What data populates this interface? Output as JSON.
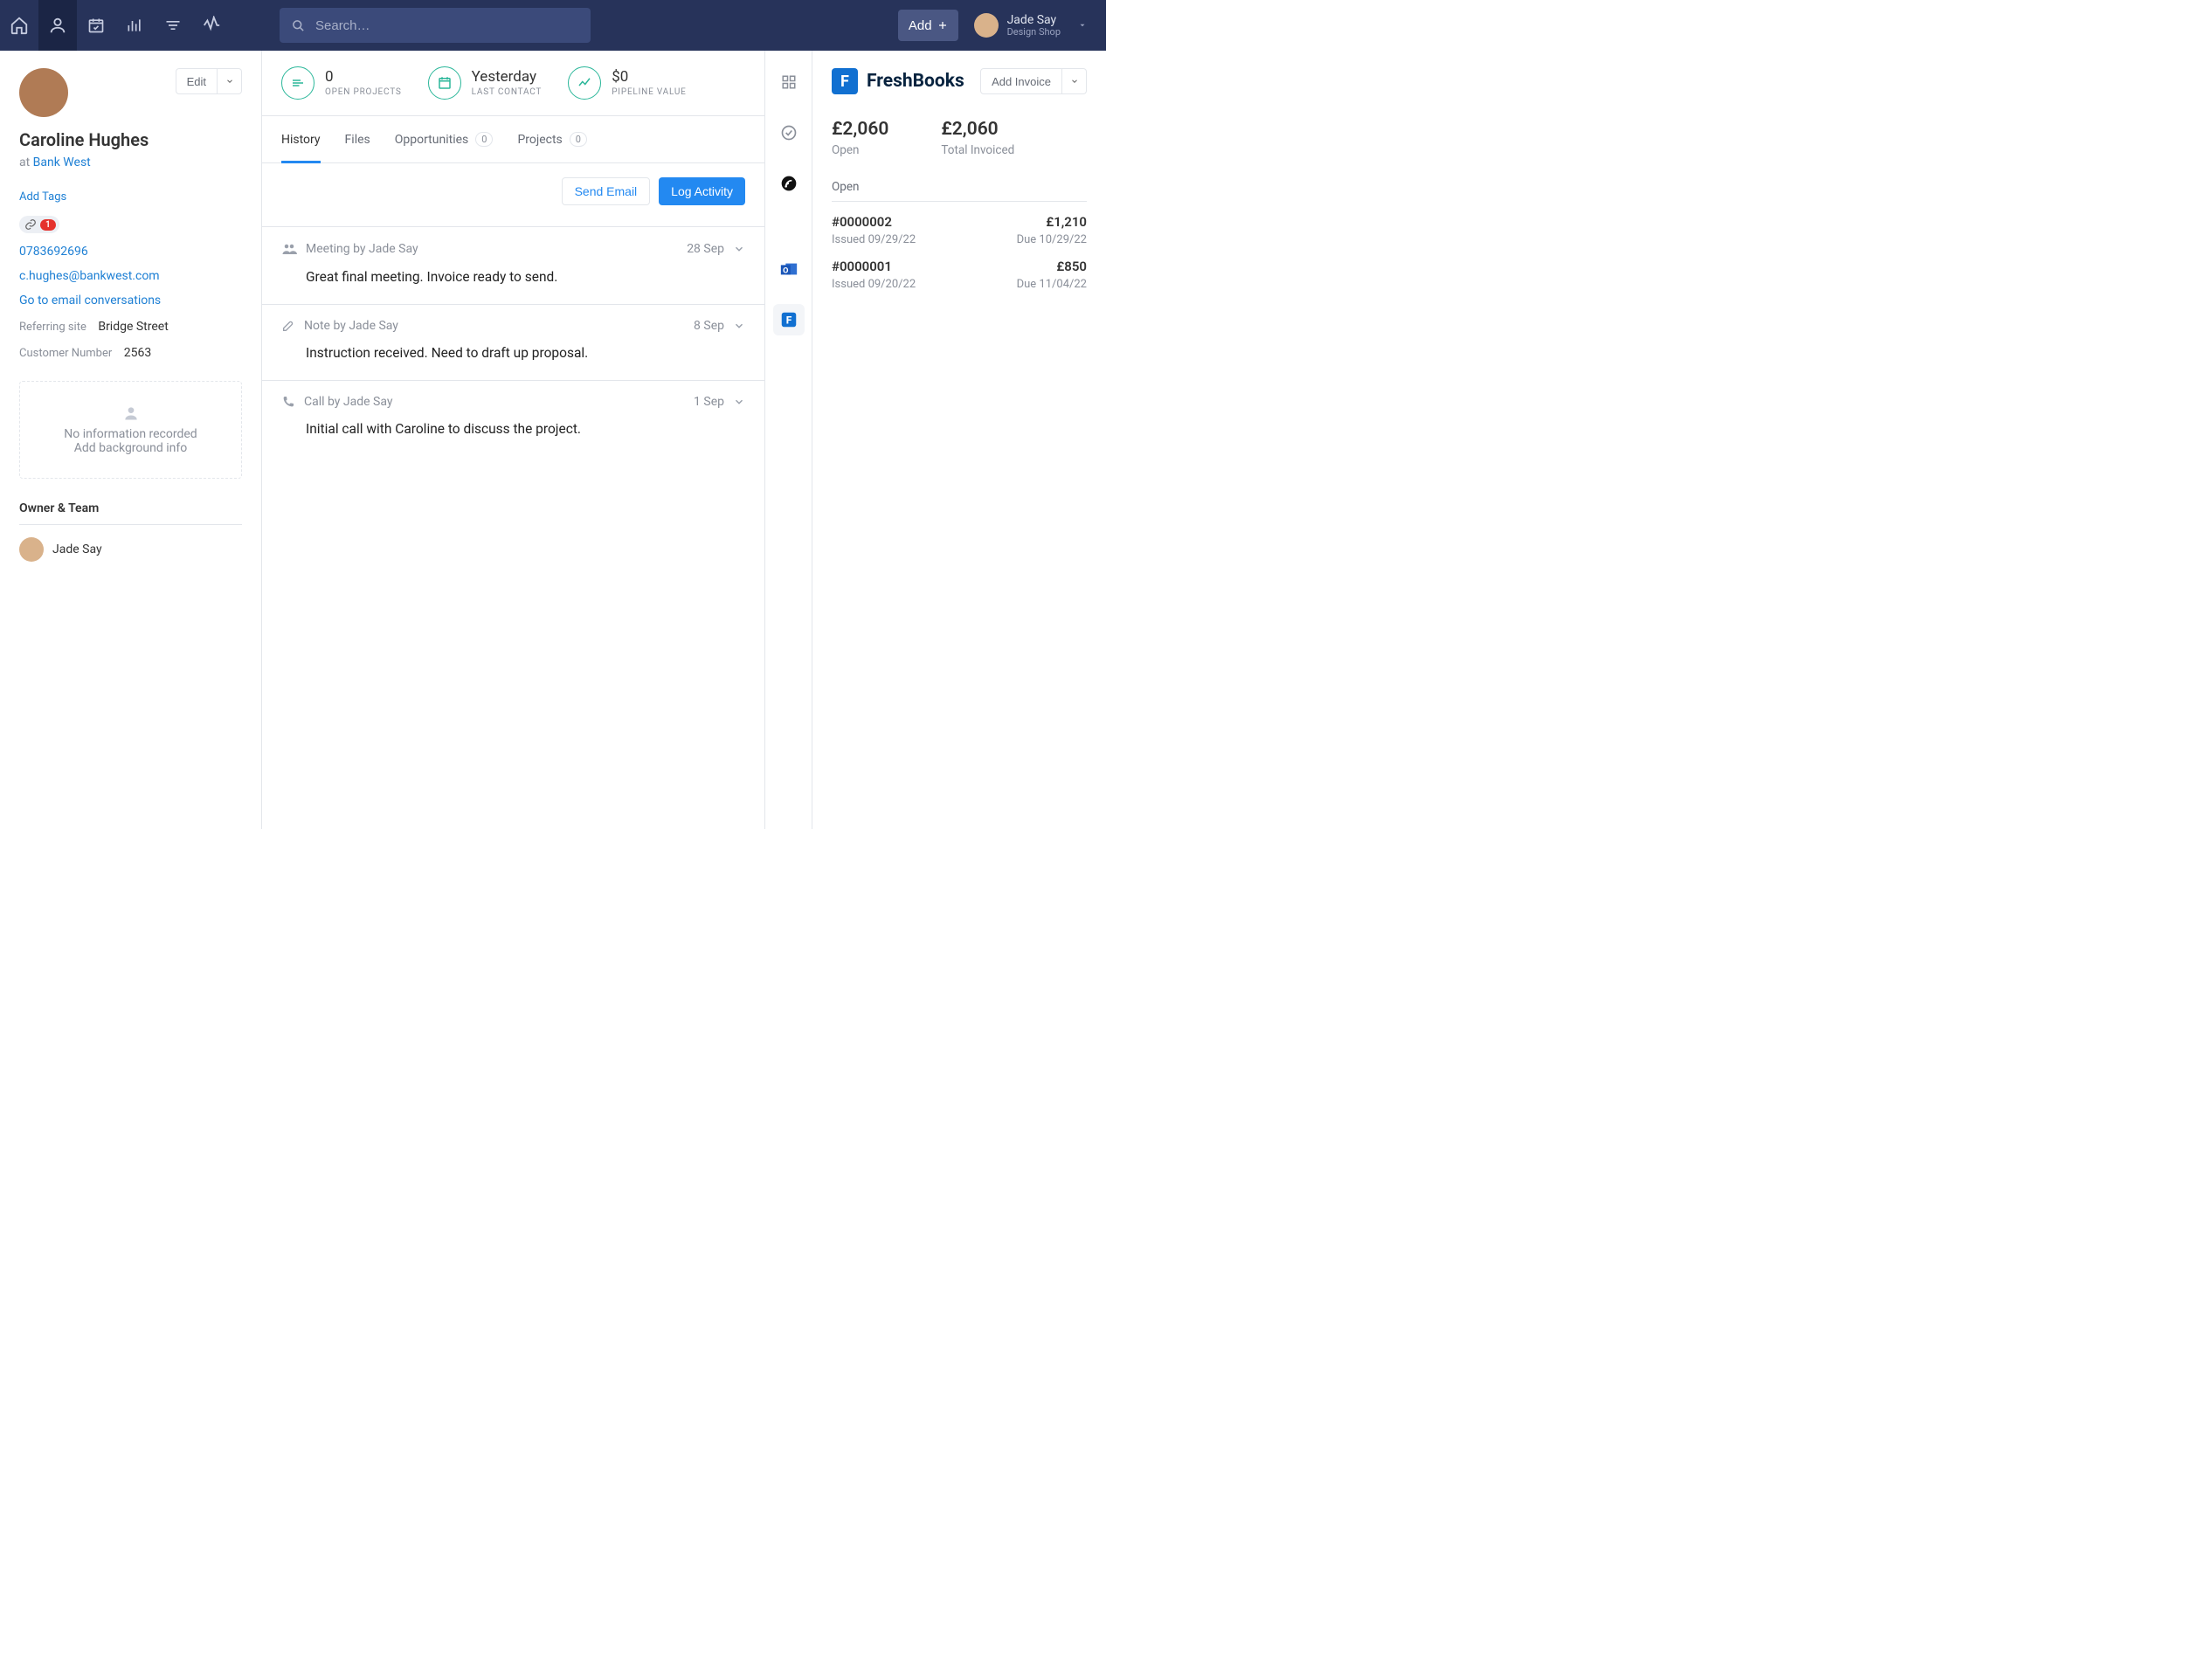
{
  "topnav": {
    "search_placeholder": "Search…",
    "add_label": "Add",
    "user_name": "Jade Say",
    "user_sub": "Design Shop"
  },
  "left": {
    "edit_label": "Edit",
    "name": "Caroline Hughes",
    "at_prefix": "at ",
    "company": "Bank West",
    "add_tags": "Add Tags",
    "tracked_count": "1",
    "phone": "0783692696",
    "email": "c.hughes@bankwest.com",
    "go_conv": "Go to email conversations",
    "referring_label": "Referring site",
    "referring_value": "Bridge Street",
    "customer_label": "Customer Number",
    "customer_value": "2563",
    "bginfo_line1": "No information recorded",
    "bginfo_line2": "Add background info",
    "owner_team_title": "Owner & Team",
    "owner_name": "Jade Say"
  },
  "stats": {
    "open_projects_value": "0",
    "open_projects_label": "OPEN PROJECTS",
    "last_contact_value": "Yesterday",
    "last_contact_label": "LAST CONTACT",
    "pipeline_value": "$0",
    "pipeline_label": "PIPELINE VALUE"
  },
  "tabs": {
    "history": "History",
    "files": "Files",
    "opportunities": "Opportunities",
    "opportunities_count": "0",
    "projects": "Projects",
    "projects_count": "0"
  },
  "actions": {
    "send_email": "Send Email",
    "log_activity": "Log Activity"
  },
  "entries": [
    {
      "title": "Meeting by Jade Say",
      "date": "28 Sep",
      "body": "Great final meeting. Invoice ready to send."
    },
    {
      "title": "Note by Jade Say",
      "date": "8 Sep",
      "body": "Instruction received. Need to draft up proposal."
    },
    {
      "title": "Call by Jade Say",
      "date": "1 Sep",
      "body": "Initial call with Caroline to discuss the project."
    }
  ],
  "right": {
    "brand": "FreshBooks",
    "add_invoice": "Add Invoice",
    "open_value": "£2,060",
    "open_label": "Open",
    "total_value": "£2,060",
    "total_label": "Total Invoiced",
    "section_open": "Open",
    "invoices": [
      {
        "num": "#0000002",
        "issued": "Issued 09/29/22",
        "amount": "£1,210",
        "due": "Due 10/29/22"
      },
      {
        "num": "#0000001",
        "issued": "Issued 09/20/22",
        "amount": "£850",
        "due": "Due 11/04/22"
      }
    ]
  }
}
